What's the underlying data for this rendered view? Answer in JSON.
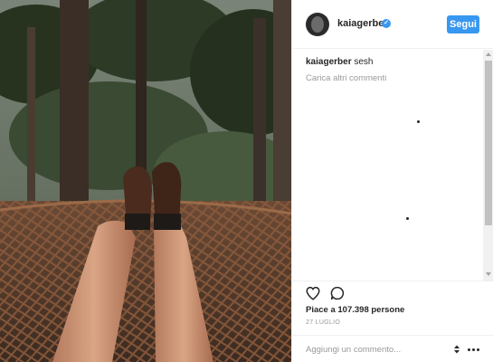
{
  "post": {
    "username": "kaiagerber",
    "verified_icon": "verified-badge-icon",
    "follow_label": "Segui",
    "caption_user": "kaiagerber",
    "caption_text": "sesh",
    "load_more_label": "Carica altri commenti",
    "likes_text": "Piace a 107.398 persone",
    "date_text": "27 LUGLIO",
    "comment_placeholder": "Aggiungi un commento..."
  },
  "icons": {
    "like": "heart-icon",
    "comment": "comment-bubble-icon",
    "more": "more-options-icon"
  },
  "colors": {
    "accent": "#3897f0",
    "text": "#262626",
    "muted": "#999999",
    "border": "#efefef"
  }
}
